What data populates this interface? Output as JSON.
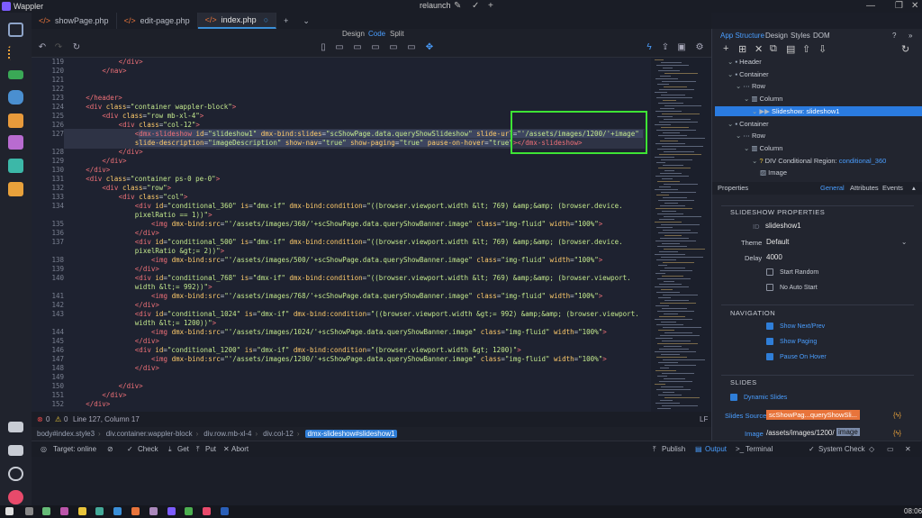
{
  "app": {
    "name": "Wappler",
    "project": "relaunch"
  },
  "tabs": [
    {
      "label": "showPage.php",
      "active": false
    },
    {
      "label": "edit-page.php",
      "active": false
    },
    {
      "label": "index.php",
      "active": true
    }
  ],
  "view_modes": {
    "design": "Design",
    "code": "Code",
    "split": "Split"
  },
  "code_lines": [
    {
      "n": "119",
      "indent": 12,
      "html": "<span class='t'>&lt;/div&gt;</span>"
    },
    {
      "n": "120",
      "indent": 8,
      "html": "<span class='t'>&lt;/nav&gt;</span>"
    },
    {
      "n": "121",
      "indent": 0,
      "html": ""
    },
    {
      "n": "122",
      "indent": 0,
      "html": ""
    },
    {
      "n": "123",
      "indent": 4,
      "html": "<span class='t'>&lt;/header&gt;</span>"
    },
    {
      "n": "124",
      "indent": 4,
      "html": "<span class='t'>&lt;div</span> <span class='a'>class</span>=<span class='s'>\"container wappler-block\"</span><span class='t'>&gt;</span>"
    },
    {
      "n": "125",
      "indent": 8,
      "html": "<span class='t'>&lt;div</span> <span class='a'>class</span>=<span class='s'>\"row mb-xl-4\"</span><span class='t'>&gt;</span>"
    },
    {
      "n": "126",
      "indent": 12,
      "html": "<span class='t'>&lt;div</span> <span class='a'>class</span>=<span class='s'>\"col-12\"</span><span class='t'>&gt;</span>"
    },
    {
      "n": "127",
      "indent": 16,
      "html": "<span class='t'>&lt;dmx-slideshow</span> <span class='a'>id</span>=<span class='s'>\"slideshow1\"</span> <span class='a'>dmx-bind:slides</span>=<span class='s'>\"scShowPage.data.queryShowSlideshow\"</span> <span class='a'>slide-url</span>=<span class='s'>\"'/assets/images/1200/'+image\"</span>"
    },
    {
      "n": "",
      "indent": 16,
      "html": "<span class='a'>slide-description</span>=<span class='s'>\"imageDescription\"</span> <span class='a'>show-nav</span>=<span class='s'>\"true\"</span> <span class='a'>show-paging</span>=<span class='s'>\"true\"</span> <span class='a'>pause-on-hover</span>=<span class='s'>\"true\"</span><span class='t'>&gt;&lt;/dmx-slideshow&gt;</span>"
    },
    {
      "n": "128",
      "indent": 12,
      "html": "<span class='t'>&lt;/div&gt;</span>"
    },
    {
      "n": "129",
      "indent": 8,
      "html": "<span class='t'>&lt;/div&gt;</span>"
    },
    {
      "n": "130",
      "indent": 4,
      "html": "<span class='t'>&lt;/div&gt;</span>"
    },
    {
      "n": "131",
      "indent": 4,
      "html": "<span class='t'>&lt;div</span> <span class='a'>class</span>=<span class='s'>\"container ps-0 pe-0\"</span><span class='t'>&gt;</span>"
    },
    {
      "n": "132",
      "indent": 8,
      "html": "<span class='t'>&lt;div</span> <span class='a'>class</span>=<span class='s'>\"row\"</span><span class='t'>&gt;</span>"
    },
    {
      "n": "133",
      "indent": 12,
      "html": "<span class='t'>&lt;div</span> <span class='a'>class</span>=<span class='s'>\"col\"</span><span class='t'>&gt;</span>"
    },
    {
      "n": "134",
      "indent": 16,
      "html": "<span class='t'>&lt;div</span> <span class='a'>id</span>=<span class='s'>\"conditional_360\"</span> <span class='a'>is</span>=<span class='s'>\"dmx-if\"</span> <span class='a'>dmx-bind:condition</span>=<span class='s'>\"((browser.viewport.width &amp;lt; 769) &amp;amp;&amp;amp; (browser.device.</span>"
    },
    {
      "n": "",
      "indent": 16,
      "html": "<span class='s'>pixelRatio == 1))\"</span><span class='t'>&gt;</span>"
    },
    {
      "n": "135",
      "indent": 20,
      "html": "<span class='t'>&lt;img</span> <span class='a'>dmx-bind:src</span>=<span class='s'>\"'/assets/images/360/'+scShowPage.data.queryShowBanner.image\"</span> <span class='a'>class</span>=<span class='s'>\"img-fluid\"</span> <span class='a'>width</span>=<span class='s'>\"100%\"</span><span class='t'>&gt;</span>"
    },
    {
      "n": "136",
      "indent": 16,
      "html": "<span class='t'>&lt;/div&gt;</span>"
    },
    {
      "n": "137",
      "indent": 16,
      "html": "<span class='t'>&lt;div</span> <span class='a'>id</span>=<span class='s'>\"conditional_500\"</span> <span class='a'>is</span>=<span class='s'>\"dmx-if\"</span> <span class='a'>dmx-bind:condition</span>=<span class='s'>\"((browser.viewport.width &amp;lt; 769) &amp;amp;&amp;amp; (browser.device.</span>"
    },
    {
      "n": "",
      "indent": 16,
      "html": "<span class='s'>pixelRatio &amp;gt;= 2))\"</span><span class='t'>&gt;</span>"
    },
    {
      "n": "138",
      "indent": 20,
      "html": "<span class='t'>&lt;img</span> <span class='a'>dmx-bind:src</span>=<span class='s'>\"'/assets/images/500/'+scShowPage.data.queryShowBanner.image\"</span> <span class='a'>class</span>=<span class='s'>\"img-fluid\"</span> <span class='a'>width</span>=<span class='s'>\"100%\"</span><span class='t'>&gt;</span>"
    },
    {
      "n": "139",
      "indent": 16,
      "html": "<span class='t'>&lt;/div&gt;</span>"
    },
    {
      "n": "140",
      "indent": 16,
      "html": "<span class='t'>&lt;div</span> <span class='a'>id</span>=<span class='s'>\"conditional_768\"</span> <span class='a'>is</span>=<span class='s'>\"dmx-if\"</span> <span class='a'>dmx-bind:condition</span>=<span class='s'>\"((browser.viewport.width &amp;lt; 769) &amp;amp;&amp;amp; (browser.viewport.</span>"
    },
    {
      "n": "",
      "indent": 16,
      "html": "<span class='s'>width &amp;lt;= 992))\"</span><span class='t'>&gt;</span>"
    },
    {
      "n": "141",
      "indent": 20,
      "html": "<span class='t'>&lt;img</span> <span class='a'>dmx-bind:src</span>=<span class='s'>\"'/assets/images/768/'+scShowPage.data.queryShowBanner.image\"</span> <span class='a'>class</span>=<span class='s'>\"img-fluid\"</span> <span class='a'>width</span>=<span class='s'>\"100%\"</span><span class='t'>&gt;</span>"
    },
    {
      "n": "142",
      "indent": 16,
      "html": "<span class='t'>&lt;/div&gt;</span>"
    },
    {
      "n": "143",
      "indent": 16,
      "html": "<span class='t'>&lt;div</span> <span class='a'>id</span>=<span class='s'>\"conditional_1024\"</span> <span class='a'>is</span>=<span class='s'>\"dmx-if\"</span> <span class='a'>dmx-bind:condition</span>=<span class='s'>\"((browser.viewport.width &amp;gt;= 992) &amp;amp;&amp;amp; (browser.viewport.</span>"
    },
    {
      "n": "",
      "indent": 16,
      "html": "<span class='s'>width &amp;lt;= 1200))\"</span><span class='t'>&gt;</span>"
    },
    {
      "n": "144",
      "indent": 20,
      "html": "<span class='t'>&lt;img</span> <span class='a'>dmx-bind:src</span>=<span class='s'>\"'/assets/images/1024/'+scShowPage.data.queryShowBanner.image\"</span> <span class='a'>class</span>=<span class='s'>\"img-fluid\"</span> <span class='a'>width</span>=<span class='s'>\"100%\"</span><span class='t'>&gt;</span>"
    },
    {
      "n": "145",
      "indent": 16,
      "html": "<span class='t'>&lt;/div&gt;</span>"
    },
    {
      "n": "146",
      "indent": 16,
      "html": "<span class='t'>&lt;div</span> <span class='a'>id</span>=<span class='s'>\"conditional_1200\"</span> <span class='a'>is</span>=<span class='s'>\"dmx-if\"</span> <span class='a'>dmx-bind:condition</span>=<span class='s'>\"(browser.viewport.width &amp;gt; 1200)\"</span><span class='t'>&gt;</span>"
    },
    {
      "n": "147",
      "indent": 20,
      "html": "<span class='t'>&lt;img</span> <span class='a'>dmx-bind:src</span>=<span class='s'>\"'/assets/images/1200/'+scShowPage.data.queryShowBanner.image\"</span> <span class='a'>class</span>=<span class='s'>\"img-fluid\"</span> <span class='a'>width</span>=<span class='s'>\"100%\"</span><span class='t'>&gt;</span>"
    },
    {
      "n": "148",
      "indent": 16,
      "html": "<span class='t'>&lt;/div&gt;</span>"
    },
    {
      "n": "149",
      "indent": 0,
      "html": ""
    },
    {
      "n": "150",
      "indent": 12,
      "html": "<span class='t'>&lt;/div&gt;</span>"
    },
    {
      "n": "151",
      "indent": 8,
      "html": "<span class='t'>&lt;/div&gt;</span>"
    },
    {
      "n": "152",
      "indent": 4,
      "html": "<span class='t'>&lt;/div&gt;</span>"
    }
  ],
  "status": {
    "errors": "0",
    "warnings": "0",
    "position": "Line 127, Column 17",
    "eol": "LF"
  },
  "breadcrumb": [
    "body#index.style3",
    "div.container.wappler-block",
    "div.row.mb-xl-4",
    "div.col-12",
    "dmx-slideshow#slideshow1"
  ],
  "bottombar": {
    "target_label": "Target: online",
    "check": "Check",
    "get": "Get",
    "put": "Put",
    "abort": "Abort",
    "publish": "Publish",
    "output": "Output",
    "terminal": "Terminal",
    "system_check": "System Check"
  },
  "right_tabs": {
    "app_structure": "App Structure",
    "design": "Design",
    "styles": "Styles",
    "dom": "DOM"
  },
  "tree": [
    {
      "label": "Header",
      "indent": 1,
      "icon": "square"
    },
    {
      "label": "Container",
      "indent": 1,
      "icon": "square"
    },
    {
      "label": "Row",
      "indent": 2,
      "icon": "dots"
    },
    {
      "label": "Column",
      "indent": 3,
      "icon": "column"
    },
    {
      "label": "Slideshow: slideshow1",
      "indent": 4,
      "icon": "play",
      "selected": true
    },
    {
      "label": "Container",
      "indent": 1,
      "icon": "square"
    },
    {
      "label": "Row",
      "indent": 2,
      "icon": "dots"
    },
    {
      "label": "Column",
      "indent": 3,
      "icon": "column"
    },
    {
      "label": "DIV Conditional Region: ",
      "extra": "conditional_360",
      "indent": 4,
      "icon": "question"
    },
    {
      "label": "Image",
      "indent": 5,
      "icon": "image"
    }
  ],
  "props": {
    "title": "Properties",
    "tab_general": "General",
    "tab_attributes": "Attributes",
    "tab_events": "Events",
    "section_slideshow": "SLIDESHOW PROPERTIES",
    "id_label": "ID",
    "id_value": "slideshow1",
    "theme_label": "Theme",
    "theme_value": "Default",
    "delay_label": "Delay",
    "delay_value": "4000",
    "start_random": "Start Random",
    "no_auto_start": "No Auto Start",
    "section_navigation": "NAVIGATION",
    "show_next_prev": "Show Next/Prev",
    "show_paging": "Show Paging",
    "pause_on_hover": "Pause On Hover",
    "section_slides": "SLIDES",
    "dynamic_slides": "Dynamic Slides",
    "slides_source_label": "Slides Source",
    "slides_source_value": "scShowPag...queryShowSli...",
    "image_label": "Image",
    "image_prefix": "/assets/images/1200/",
    "image_token": "image"
  },
  "clock": "08:06",
  "colors": {
    "accent": "#2f7ed8",
    "highlight_box": "#3ee335",
    "token_orange": "#e8743b"
  }
}
